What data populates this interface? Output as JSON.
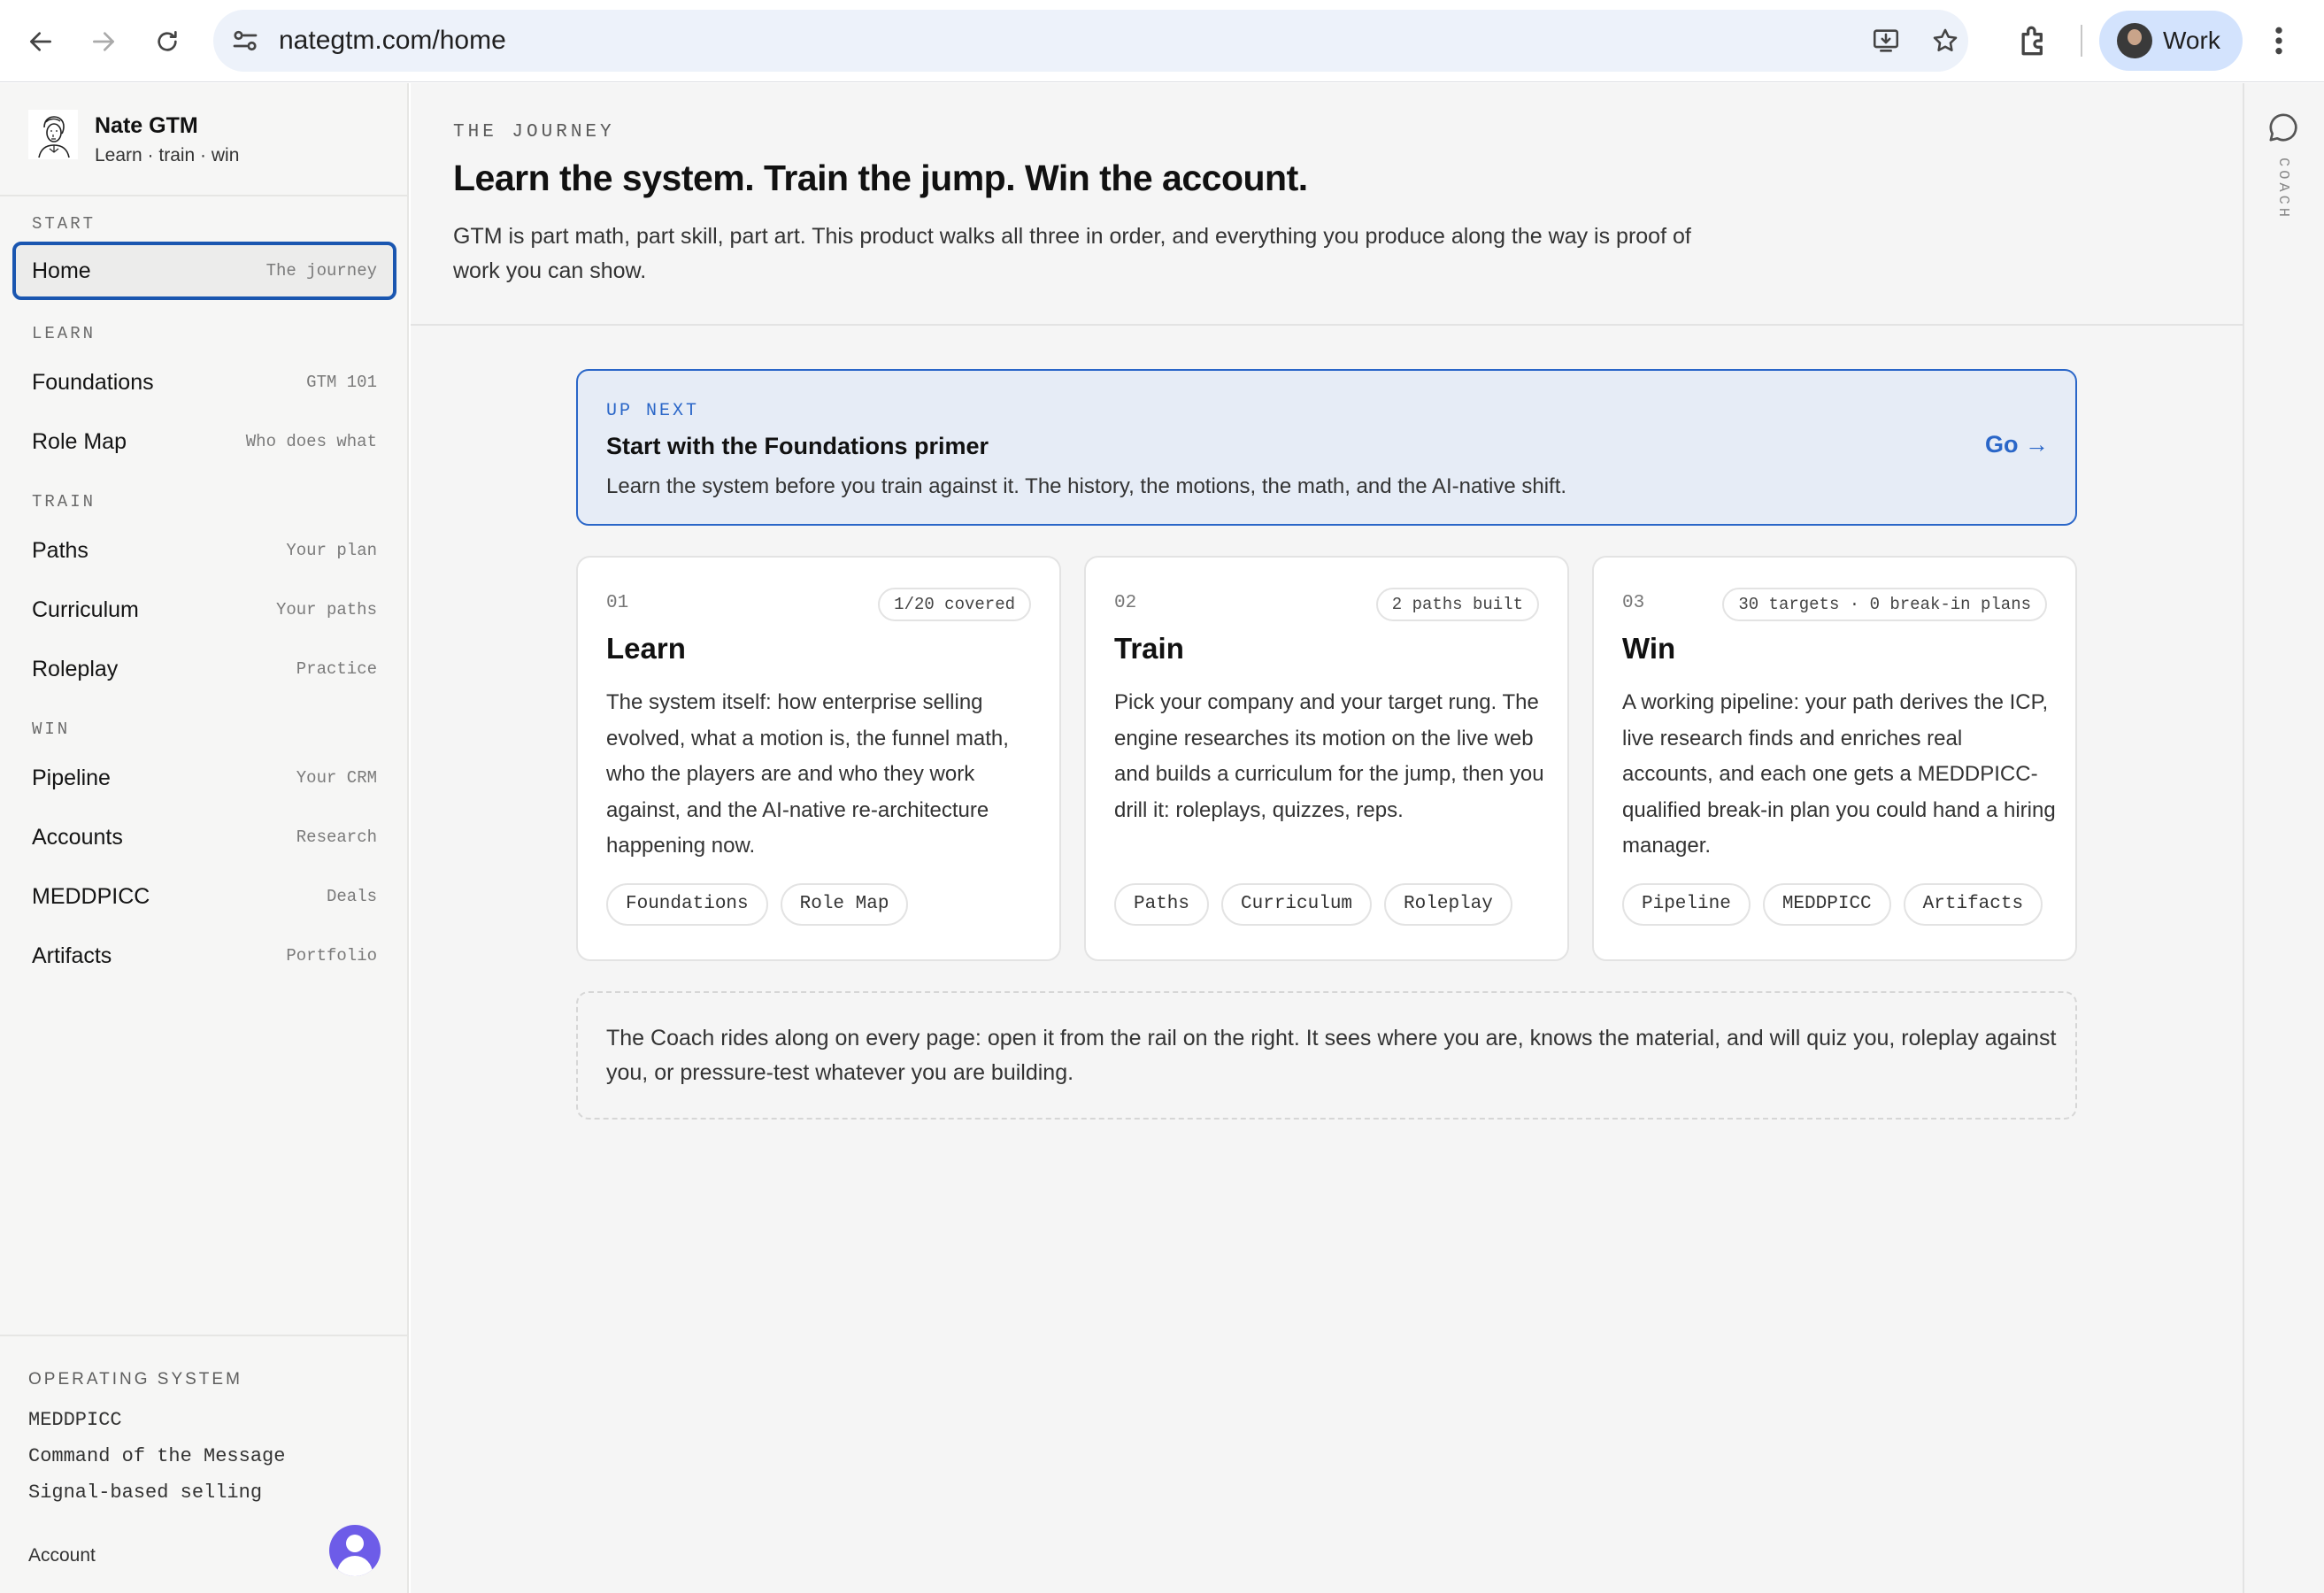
{
  "browser": {
    "url": "nategtm.com/home",
    "profile_name": "Work"
  },
  "brand": {
    "name": "Nate GTM",
    "tagline": "Learn · train · win"
  },
  "sidebar": {
    "sections": [
      {
        "label": "START"
      },
      {
        "label": "LEARN"
      },
      {
        "label": "TRAIN"
      },
      {
        "label": "WIN"
      }
    ],
    "items": [
      {
        "label": "Home",
        "hint": "The journey",
        "active": true
      },
      {
        "label": "Foundations",
        "hint": "GTM 101"
      },
      {
        "label": "Role Map",
        "hint": "Who does what"
      },
      {
        "label": "Paths",
        "hint": "Your plan"
      },
      {
        "label": "Curriculum",
        "hint": "Your paths"
      },
      {
        "label": "Roleplay",
        "hint": "Practice"
      },
      {
        "label": "Pipeline",
        "hint": "Your CRM"
      },
      {
        "label": "Accounts",
        "hint": "Research"
      },
      {
        "label": "MEDDPICC",
        "hint": "Deals"
      },
      {
        "label": "Artifacts",
        "hint": "Portfolio"
      }
    ],
    "footer": {
      "label": "OPERATING SYSTEM",
      "items": [
        "MEDDPICC",
        "Command of the Message",
        "Signal-based selling"
      ],
      "account_label": "Account"
    }
  },
  "hero": {
    "eyebrow": "THE JOURNEY",
    "title": "Learn the system. Train the jump. Win the account.",
    "lede": "GTM is part math, part skill, part art. This product walks all three in order, and everything you produce along the way is proof of work you can show."
  },
  "up_next": {
    "eyebrow": "UP NEXT",
    "title": "Start with the Foundations primer",
    "description": "Learn the system before you train against it. The history, the motions, the math, and the AI-native shift.",
    "cta": "Go →"
  },
  "cards": [
    {
      "number": "01",
      "badge": "1/20 covered",
      "title": "Learn",
      "body": "The system itself: how enterprise selling evolved, what a motion is, the funnel math, who the players are and who they work against, and the AI-native re-architecture happening now.",
      "tags": [
        "Foundations",
        "Role Map"
      ]
    },
    {
      "number": "02",
      "badge": "2 paths built",
      "title": "Train",
      "body": "Pick your company and your target rung. The engine researches its motion on the live web and builds a curriculum for the jump, then you drill it: roleplays, quizzes, reps.",
      "tags": [
        "Paths",
        "Curriculum",
        "Roleplay"
      ]
    },
    {
      "number": "03",
      "badge": "30 targets · 0 break-in plans",
      "title": "Win",
      "body": "A working pipeline: your path derives the ICP, live research finds and enriches real accounts, and each one gets a MEDDPICC-qualified break-in plan you could hand a hiring manager.",
      "tags": [
        "Pipeline",
        "MEDDPICC",
        "Artifacts"
      ]
    }
  ],
  "coach_note": "The Coach rides along on every page: open it from the rail on the right. It sees where you are, knows the material, and will quiz you, roleplay against you, or pressure-test whatever you are building.",
  "rail": {
    "label": "COACH"
  },
  "colors": {
    "accent": "#2a66c8",
    "active_border": "#1a56b0",
    "upnext_bg": "#e6ecf6",
    "avatar": "#6d5ce8"
  }
}
